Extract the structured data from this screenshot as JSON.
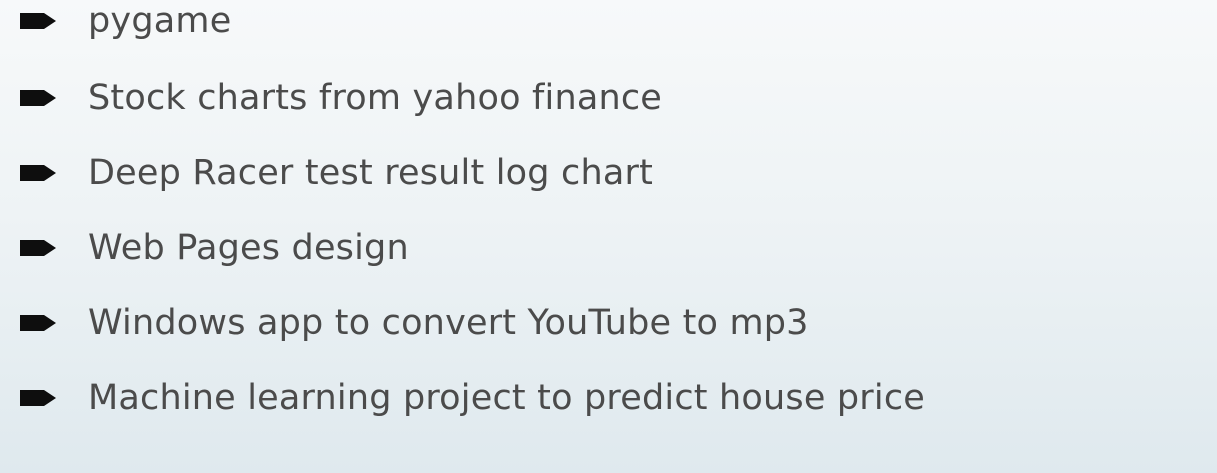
{
  "bullets": {
    "items": [
      {
        "label": "pygame"
      },
      {
        "label": "Stock charts from yahoo finance"
      },
      {
        "label": "Deep Racer test result log chart"
      },
      {
        "label": "Web Pages design"
      },
      {
        "label": "Windows app to convert YouTube to mp3"
      },
      {
        "label": "Machine learning project to predict house price"
      }
    ],
    "icon": "arrow-bullet-icon"
  },
  "colors": {
    "text": "#4b4b4b",
    "bullet": "#0e0e0e",
    "background_top": "#f7f9fa",
    "background_bottom": "#dfe9ee"
  }
}
